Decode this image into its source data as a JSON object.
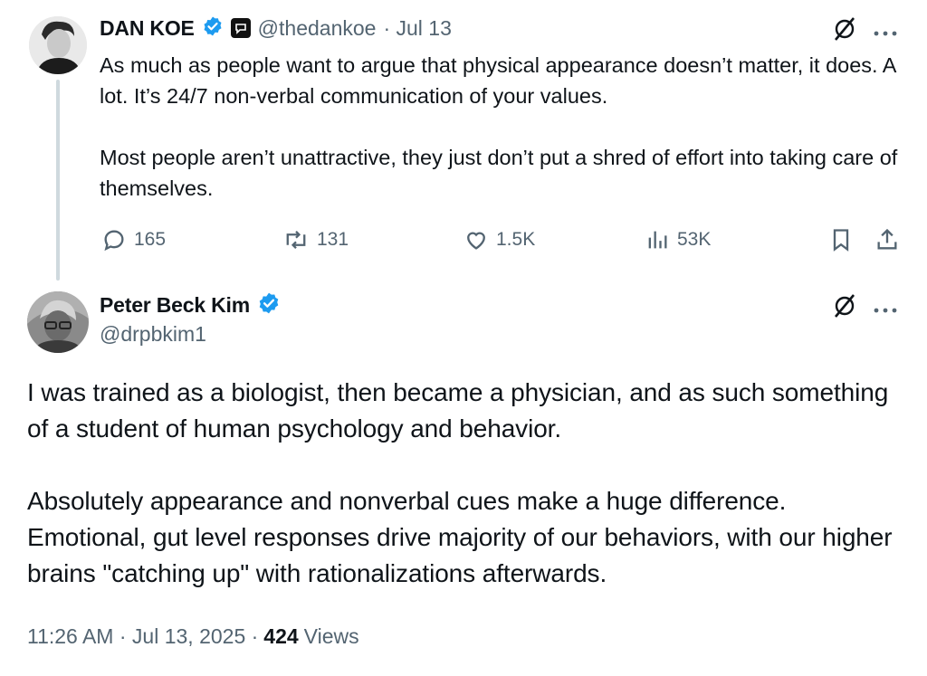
{
  "tweet1": {
    "name": "DAN KOE",
    "handle": "@thedankoe",
    "date": "· Jul 13",
    "text_p1": "As much as people want to argue that physical appearance doesn’t matter, it does. A lot. It’s 24/7 non-verbal communication of your values.",
    "text_p2": "Most people aren’t unattractive, they just don’t put a shred of effort into taking care of themselves.",
    "replies": "165",
    "reposts": "131",
    "likes": "1.5K",
    "views": "53K"
  },
  "tweet2": {
    "name": "Peter Beck Kim",
    "handle": "@drpbkim1",
    "text_p1": "I was trained as a biologist, then became a physician, and as such something of a student of human psychology and behavior.",
    "text_p2": "Absolutely appearance and nonverbal cues make a huge difference. Emotional, gut level responses drive majority of our behaviors, with our higher brains \"catching up\" with rationalizations afterwards.",
    "time": "11:26 AM · Jul 13, 2025 ·",
    "view_count": "424",
    "views_label": "Views"
  },
  "colors": {
    "verified": "#1d9bf0",
    "muted": "#536471",
    "text": "#0f1419"
  },
  "icons": [
    "verified-badge-icon",
    "affiliate-badge-icon",
    "grok-icon",
    "more-icon",
    "reply-icon",
    "repost-icon",
    "like-icon",
    "views-icon",
    "bookmark-icon",
    "share-icon"
  ]
}
